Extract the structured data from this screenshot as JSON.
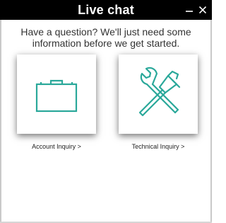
{
  "window": {
    "title": "Live chat",
    "controls": [
      {
        "name": "minimize",
        "icon": "minimize-icon"
      },
      {
        "name": "close",
        "icon": "close-icon"
      }
    ]
  },
  "intro": {
    "line1": "Have a question? We'll just need some",
    "line2": "information before we get started."
  },
  "options": [
    {
      "label": "Account Inquiry >",
      "icon": "briefcase-icon"
    },
    {
      "label": "Technical Inquiry >",
      "icon": "wrench-hammer-icon"
    }
  ],
  "colors": {
    "titlebar": "#000000",
    "title_text": "#ffffff",
    "accent_teal": "#2aa89a",
    "body_text": "#333333"
  }
}
